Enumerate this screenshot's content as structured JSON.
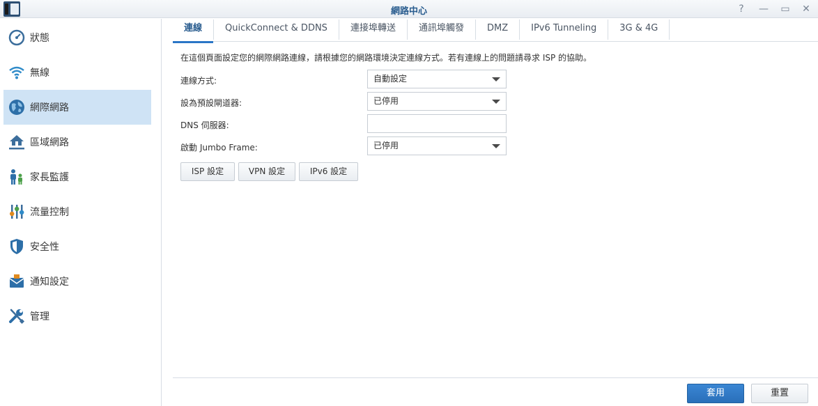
{
  "window": {
    "title": "網路中心",
    "help": "?",
    "minimize": "—",
    "maximize": "▭",
    "close": "✕"
  },
  "sidebar": {
    "items": [
      {
        "label": "狀態",
        "icon": "gauge-icon"
      },
      {
        "label": "無線",
        "icon": "wifi-icon"
      },
      {
        "label": "網際網路",
        "icon": "globe-icon",
        "active": true
      },
      {
        "label": "區域網路",
        "icon": "home-network-icon"
      },
      {
        "label": "家長監護",
        "icon": "family-icon"
      },
      {
        "label": "流量控制",
        "icon": "sliders-icon"
      },
      {
        "label": "安全性",
        "icon": "shield-icon"
      },
      {
        "label": "通知設定",
        "icon": "notification-icon"
      },
      {
        "label": "管理",
        "icon": "tools-icon"
      }
    ]
  },
  "tabs": [
    {
      "label": "連線",
      "active": true
    },
    {
      "label": "QuickConnect & DDNS"
    },
    {
      "label": "連接埠轉送"
    },
    {
      "label": "通訊埠觸發"
    },
    {
      "label": "DMZ"
    },
    {
      "label": "IPv6 Tunneling"
    },
    {
      "label": "3G & 4G"
    }
  ],
  "main": {
    "description": "在這個頁面設定您的網際網路連線，請根據您的網路環境決定連線方式。若有連線上的問題請尋求 ISP 的協助。",
    "fields": {
      "connection_type": {
        "label": "連線方式:",
        "value": "自動設定"
      },
      "default_gateway": {
        "label": "設為預設閘道器:",
        "value": "已停用"
      },
      "dns_server": {
        "label": "DNS 伺服器:",
        "value": ""
      },
      "jumbo_frame": {
        "label": "啟動 Jumbo Frame:",
        "value": "已停用"
      }
    },
    "buttons": {
      "isp": "ISP 設定",
      "vpn": "VPN 設定",
      "ipv6": "IPv6 設定"
    }
  },
  "footer": {
    "apply": "套用",
    "reset": "重置"
  },
  "colors": {
    "accent": "#2a76c6",
    "active_sidebar": "#cfe3f5",
    "title_text": "#2a5d8f"
  }
}
